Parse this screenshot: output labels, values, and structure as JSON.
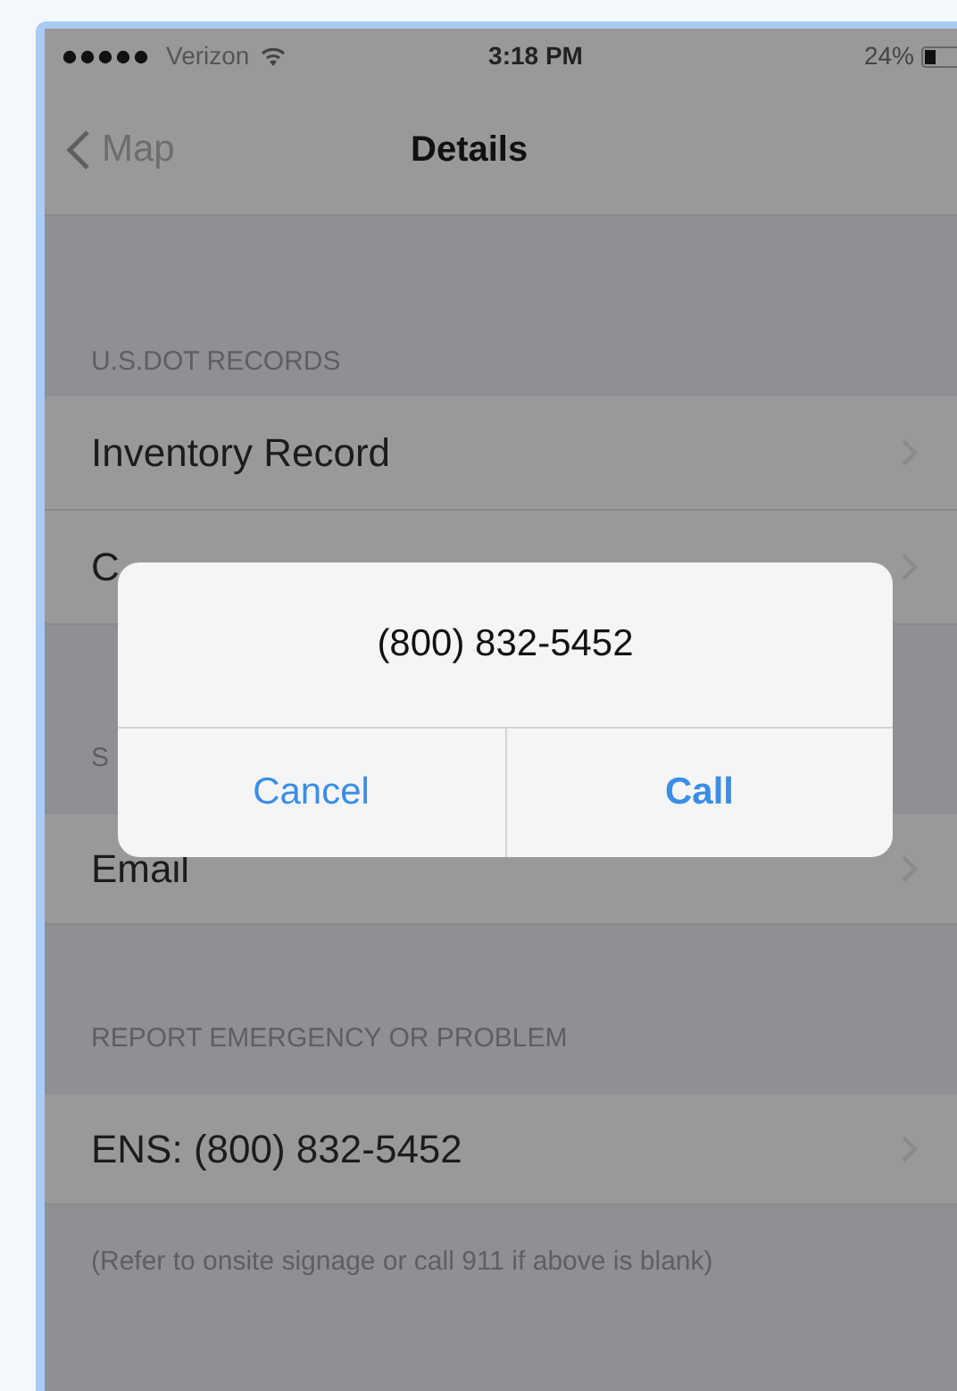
{
  "status_bar": {
    "carrier": "Verizon",
    "time": "3:18 PM",
    "battery": "24%"
  },
  "nav": {
    "back": "Map",
    "title": "Details"
  },
  "sections": [
    {
      "header": "U.S.DOT RECORDS",
      "rows": [
        {
          "text": "Inventory Record"
        },
        {
          "text": "C"
        }
      ]
    },
    {
      "header": "S",
      "rows": [
        {
          "text": "Email"
        }
      ]
    },
    {
      "header": "REPORT EMERGENCY OR PROBLEM",
      "rows": [
        {
          "text": "ENS: (800) 832-5452"
        }
      ],
      "footer": "(Refer to onsite signage or call 911 if above is blank)"
    }
  ],
  "alert": {
    "title": "(800) 832-5452",
    "buttons": [
      {
        "label": "Cancel",
        "kind": "cancel"
      },
      {
        "label": "Call",
        "kind": "default"
      }
    ]
  }
}
